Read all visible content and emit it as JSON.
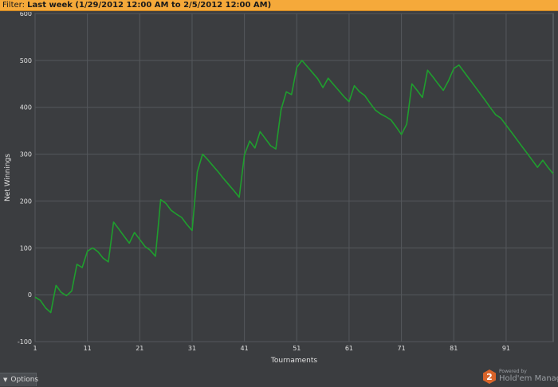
{
  "filter": {
    "prefix": "Filter: ",
    "value": "Last week (1/29/2012 12:00 AM to 2/5/2012 12:00 AM)"
  },
  "options": {
    "label": "Options"
  },
  "brand": {
    "powered": "Powered by",
    "name": "Hold'em Manager",
    "logo_glyph": "2"
  },
  "colors": {
    "background": "#3b3d40",
    "filter_bar": "#f5a93a",
    "line": "#1f9e2e",
    "grid": "#55585c",
    "axis_text": "#e0e0e0",
    "logo": "#d9642a"
  },
  "chart_data": {
    "type": "line",
    "xlabel": "Tournaments",
    "ylabel": "Net Winnings",
    "xlim": [
      1,
      100
    ],
    "ylim": [
      -100,
      600
    ],
    "xticks": [
      1,
      11,
      21,
      31,
      41,
      51,
      61,
      71,
      81,
      91
    ],
    "yticks": [
      -100,
      0,
      100,
      200,
      300,
      400,
      500,
      600
    ],
    "grid": true,
    "series": [
      {
        "x": [
          1,
          2,
          3,
          4,
          5,
          6,
          7,
          8,
          9,
          10,
          11,
          12,
          13,
          14,
          15,
          16,
          17,
          18,
          19,
          20,
          21,
          22,
          23,
          24,
          25,
          26,
          27,
          28,
          29,
          30,
          31,
          32,
          33,
          34,
          35,
          36,
          37,
          38,
          39,
          40,
          41,
          42,
          43,
          44,
          45,
          46,
          47,
          48,
          49,
          50,
          51,
          52,
          53,
          54,
          55,
          56,
          57,
          58,
          59,
          60,
          61,
          62,
          63,
          64,
          65,
          66,
          67,
          68,
          69,
          70,
          71,
          72,
          73,
          74,
          75,
          76,
          77,
          78,
          79,
          80,
          81,
          82,
          83,
          84,
          85,
          86,
          87,
          88,
          89,
          90,
          91,
          92,
          93,
          94,
          95,
          96,
          97,
          98,
          99,
          100
        ],
        "y": [
          -5,
          -12,
          -28,
          -38,
          20,
          5,
          -2,
          8,
          65,
          58,
          93,
          100,
          92,
          78,
          70,
          155,
          140,
          125,
          110,
          133,
          118,
          103,
          95,
          82,
          203,
          195,
          180,
          172,
          165,
          150,
          137,
          262,
          300,
          288,
          275,
          262,
          248,
          235,
          222,
          208,
          298,
          328,
          313,
          348,
          333,
          318,
          311,
          395,
          433,
          427,
          485,
          500,
          487,
          474,
          461,
          442,
          462,
          449,
          436,
          423,
          412,
          446,
          433,
          425,
          409,
          394,
          386,
          380,
          373,
          358,
          342,
          364,
          450,
          436,
          421,
          479,
          465,
          450,
          436,
          457,
          483,
          490,
          475,
          460,
          445,
          430,
          415,
          399,
          384,
          377,
          362,
          347,
          332,
          317,
          302,
          287,
          272,
          287,
          272,
          258
        ]
      }
    ]
  }
}
